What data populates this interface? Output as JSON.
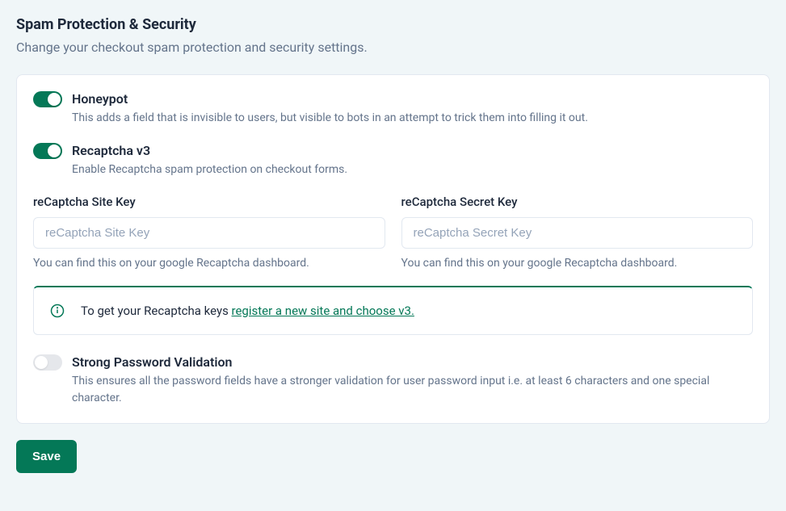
{
  "header": {
    "title": "Spam Protection & Security",
    "subtitle": "Change your checkout spam protection and security settings."
  },
  "toggles": {
    "honeypot": {
      "label": "Honeypot",
      "description": "This adds a field that is invisible to users, but visible to bots in an attempt to trick them into filling it out.",
      "enabled": true
    },
    "recaptcha": {
      "label": "Recaptcha v3",
      "description": "Enable Recaptcha spam protection on checkout forms.",
      "enabled": true
    },
    "strong_password": {
      "label": "Strong Password Validation",
      "description": "This ensures all the password fields have a stronger validation for user password input i.e. at least 6 characters and one special character.",
      "enabled": false
    }
  },
  "fields": {
    "site_key": {
      "label": "reCaptcha Site Key",
      "placeholder": "reCaptcha Site Key",
      "hint": "You can find this on your google Recaptcha dashboard."
    },
    "secret_key": {
      "label": "reCaptcha Secret Key",
      "placeholder": "reCaptcha Secret Key",
      "hint": "You can find this on your google Recaptcha dashboard."
    }
  },
  "alert": {
    "text": "To get your Recaptcha keys ",
    "link_text": "register a new site and choose v3."
  },
  "actions": {
    "save": "Save"
  }
}
